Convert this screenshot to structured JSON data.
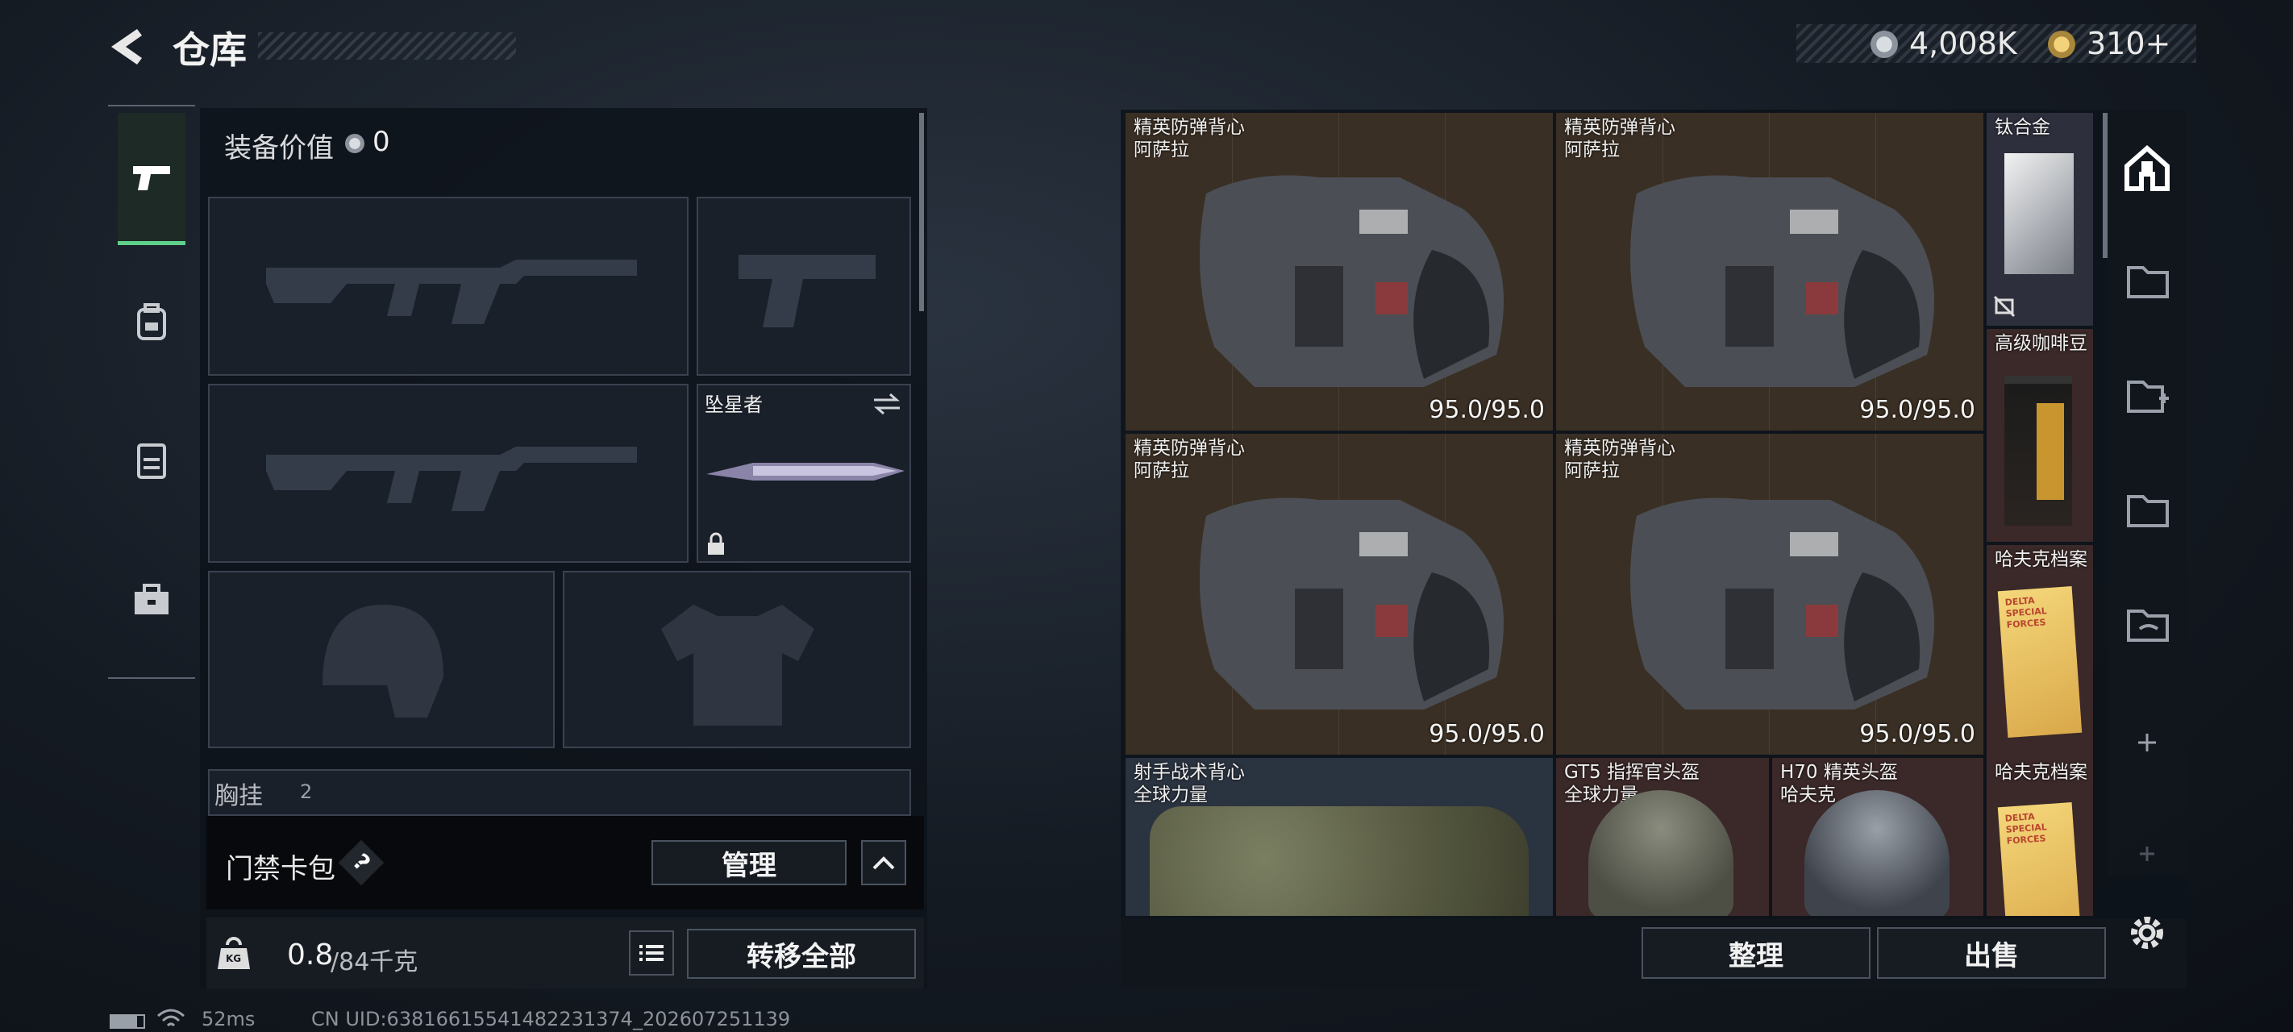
{
  "header": {
    "title": "仓库",
    "currency_1": "4,008K",
    "currency_2": "310+"
  },
  "left_panel": {
    "equip_value_label": "装备价值",
    "equip_value": "0",
    "melee_name": "坠星者",
    "chest_label": "胸挂",
    "chest_count": "2",
    "keycard_label": "门禁卡包",
    "keycard_help": "?",
    "manage_button": "管理",
    "weight": "0.8",
    "weight_max": "/84千克",
    "weight_icon_text": "KG",
    "transfer_all_button": "转移全部"
  },
  "stash": {
    "vest_items": [
      {
        "name": "精英防弹背心",
        "brand": "阿萨拉",
        "durability": "95.0/95.0"
      },
      {
        "name": "精英防弹背心",
        "brand": "阿萨拉",
        "durability": "95.0/95.0"
      },
      {
        "name": "精英防弹背心",
        "brand": "阿萨拉",
        "durability": "95.0/95.0"
      },
      {
        "name": "精英防弹背心",
        "brand": "阿萨拉",
        "durability": "95.0/95.0"
      }
    ],
    "side_items": [
      {
        "name": "钛合金"
      },
      {
        "name": "高级咖啡豆"
      },
      {
        "name": "哈夫克档案"
      },
      {
        "name": "哈夫克档案"
      }
    ],
    "bottom_items": [
      {
        "name": "射手战术背心",
        "brand": "全球力量"
      },
      {
        "name": "GT5 指挥官头盔",
        "brand": "全球力量"
      },
      {
        "name": "H70 精英头盔",
        "brand": "哈夫克"
      }
    ],
    "file_cover_text": "DELTA SPECIAL FORCES",
    "sort_button": "整理",
    "sell_button": "出售"
  },
  "status_bar": {
    "ping": "52ms",
    "uid": "CN UID:63816615541482231374_202607251139"
  },
  "colors": {
    "vest_bg": "#3a2f24",
    "side_bg_a": "#2e2f3c",
    "side_bg_b": "#3b2828",
    "accent_green": "#5fd08a"
  }
}
